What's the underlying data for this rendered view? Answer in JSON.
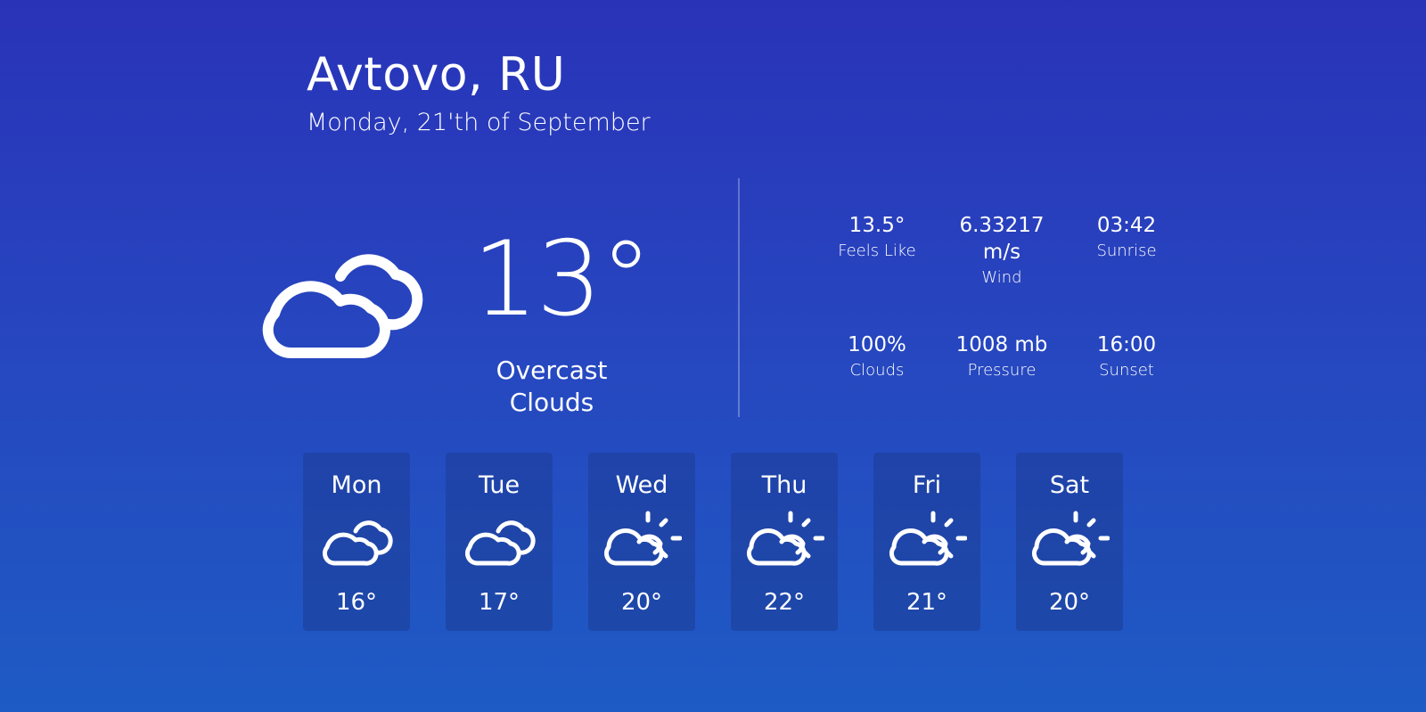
{
  "location": {
    "city": "Avtovo, RU",
    "date": "Monday, 21'th of September"
  },
  "current": {
    "icon": "overcast-clouds-icon",
    "temperature": "13°",
    "condition": "Overcast Clouds"
  },
  "stats": [
    {
      "value": "13.5°",
      "label": "Feels Like"
    },
    {
      "value": "6.33217 m/s",
      "label": "Wind"
    },
    {
      "value": "03:42",
      "label": "Sunrise"
    },
    {
      "value": "100%",
      "label": "Clouds"
    },
    {
      "value": "1008 mb",
      "label": "Pressure"
    },
    {
      "value": "16:00",
      "label": "Sunset"
    }
  ],
  "forecast": [
    {
      "day": "Mon",
      "icon": "clouds-icon",
      "temp": "16°"
    },
    {
      "day": "Tue",
      "icon": "clouds-icon",
      "temp": "17°"
    },
    {
      "day": "Wed",
      "icon": "partly-cloudy-icon",
      "temp": "20°"
    },
    {
      "day": "Thu",
      "icon": "partly-cloudy-icon",
      "temp": "22°"
    },
    {
      "day": "Fri",
      "icon": "partly-cloudy-icon",
      "temp": "21°"
    },
    {
      "day": "Sat",
      "icon": "partly-cloudy-icon",
      "temp": "20°"
    }
  ],
  "colors": {
    "background_top": "#2933b8",
    "background_bottom": "#1e5bc4",
    "card": "#2147a6",
    "text": "#ffffff"
  }
}
